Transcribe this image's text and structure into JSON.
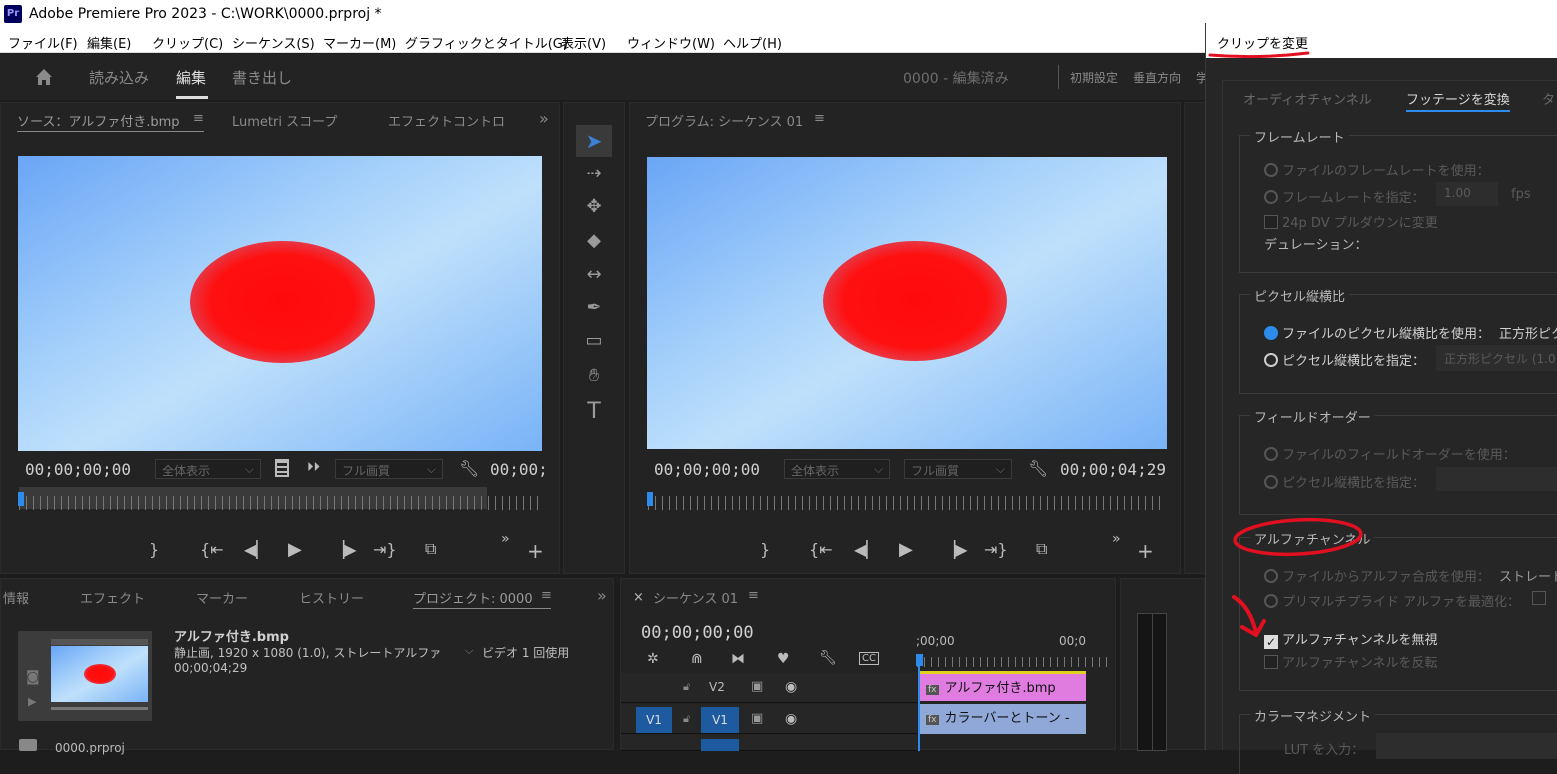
{
  "app": {
    "badge": "Pr",
    "title": "Adobe Premiere Pro 2023 - C:\\WORK\\0000.prproj *"
  },
  "menu": [
    "ファイル(F)",
    "編集(E)",
    "クリップ(C)",
    "シーケンス(S)",
    "マーカー(M)",
    "グラフィックとタイトル(G)",
    "表示(V)",
    "ウィンドウ(W)",
    "ヘルプ(H)"
  ],
  "workspace": {
    "tabs": [
      "読み込み",
      "編集",
      "書き出し"
    ],
    "project_status": "0000 - 編集済み",
    "right_tabs": [
      "初期設定",
      "垂直方向",
      "学"
    ]
  },
  "source_monitor": {
    "tabs": [
      "ソース：アルファ付き.bmp",
      "Lumetri スコープ",
      "エフェクトコントロ"
    ],
    "timecode_in": "00;00;00;00",
    "fit": "全体表示",
    "quality": "フル画質",
    "timecode_out": "00;00;"
  },
  "program_monitor": {
    "tab": "プログラム: シーケンス 01",
    "timecode_in": "00;00;00;00",
    "fit": "全体表示",
    "quality": "フル画質",
    "timecode_out": "00;00;04;29"
  },
  "project_panel": {
    "tabs": [
      "情報",
      "エフェクト",
      "マーカー",
      "ヒストリー",
      "プロジェクト: 0000"
    ],
    "item_name": "アルファ付き.bmp",
    "item_info": "静止画, 1920 x 1080 (1.0), ストレートアルファ",
    "item_usage": "ビデオ 1 回使用",
    "item_duration": "00;00;04;29",
    "project_file": "0000.prproj"
  },
  "timeline": {
    "tab": "シーケンス 01",
    "timecode": "00;00;00;00",
    "ruler_start": ";00;00",
    "ruler_end": "00;0",
    "tracks": [
      {
        "name": "V2",
        "clip": "アルファ付き.bmp",
        "color": "#e07be0"
      },
      {
        "name": "V1",
        "source": "V1",
        "clip": "カラーバーとトーン -",
        "color": "#8fa8d8"
      }
    ]
  },
  "dialog": {
    "title": "クリップを変更",
    "tabs": [
      "オーディオチャンネル",
      "フッテージを変換",
      "タ"
    ],
    "framerate": {
      "legend": "フレームレート",
      "use_file": "ファイルのフレームレートを使用：",
      "assume": "フレームレートを指定：",
      "assume_value": "1.00",
      "unit": "fps",
      "pulldown": "24p DV プルダウンに変更",
      "duration": "デュレーション："
    },
    "pixel_aspect": {
      "legend": "ピクセル縦横比",
      "use_file": "ファイルのピクセル縦横比を使用：",
      "use_file_value": "正方形ピク",
      "conform": "ピクセル縦横比を指定：",
      "conform_value": "正方形ピクセル (1.0"
    },
    "field_order": {
      "legend": "フィールドオーダー",
      "use_file": "ファイルのフィールドオーダーを使用：",
      "conform": "ピクセル縦横比を指定："
    },
    "alpha": {
      "legend": "アルファチャンネル",
      "use_file": "ファイルからアルファ合成を使用：",
      "use_file_value": "ストレート",
      "premultiplied": "プリマルチプライド アルファを最適化：",
      "ignore": "アルファチャンネルを無視",
      "invert": "アルファチャンネルを反転",
      "ignore_checked": true
    },
    "color": {
      "legend": "カラーマネジメント",
      "lut": "LUT を入力："
    }
  },
  "accent": "#2d8ceb",
  "annotation_color": "#e01020"
}
